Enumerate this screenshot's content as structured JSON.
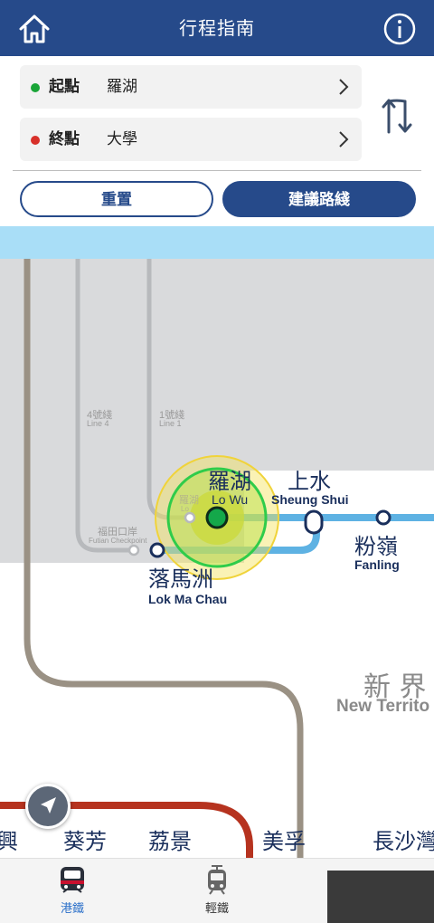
{
  "header": {
    "title": "行程指南",
    "home_icon": "home-icon",
    "info_icon": "info-icon"
  },
  "route": {
    "origin": {
      "label": "起點",
      "value": "羅湖",
      "dot_color": "#1aa538"
    },
    "destination": {
      "label": "終點",
      "value": "大學",
      "dot_color": "#d8302a"
    },
    "swap_icon": "swap-arrows-icon"
  },
  "actions": {
    "reset_label": "重置",
    "suggest_label": "建議路綫"
  },
  "map": {
    "lines": {
      "line4": {
        "zh": "4號綫",
        "en": "Line 4"
      },
      "line1": {
        "zh": "1號綫",
        "en": "Line 1"
      }
    },
    "futian": {
      "zh": "福田口岸",
      "en": "Futian Checkpoint"
    },
    "faded_station": {
      "zh": "羅湖",
      "en": "Lo"
    },
    "stations": {
      "lowu": {
        "zh": "羅湖",
        "en": "Lo Wu"
      },
      "sheungshui": {
        "zh": "上水",
        "en": "Sheung Shui"
      },
      "fanling": {
        "zh": "粉嶺",
        "en": "Fanling"
      },
      "lokmachau": {
        "zh": "落馬洲",
        "en": "Lok Ma Chau"
      }
    },
    "region": {
      "zh": "新 界",
      "en": "New Territo"
    },
    "bottom_stations": [
      "興",
      "葵芳",
      "荔景",
      "美孚",
      "長沙灣"
    ],
    "colors": {
      "east_rail": "#5eb2e3",
      "tuen_ma": "#9a9184",
      "tsuen_wan": "#b6331f",
      "selected_ring": "#2fcc4a"
    }
  },
  "tabs": [
    {
      "label": "港鐵",
      "icon": "mtr-train-icon",
      "active": true
    },
    {
      "label": "輕鐵",
      "icon": "light-rail-icon",
      "active": false
    }
  ]
}
